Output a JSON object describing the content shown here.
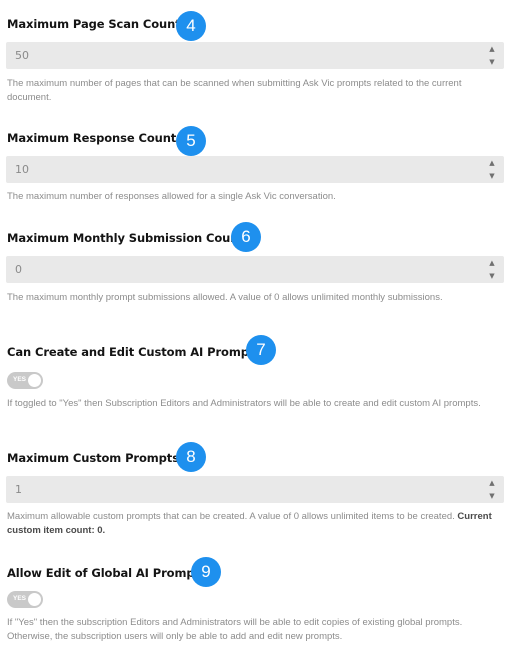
{
  "settings": [
    {
      "label": "Maximum Page Scan Count",
      "badge": "4",
      "value": "50",
      "help": "The maximum number of pages that can be scanned when submitting Ask Vic prompts related to the current document."
    },
    {
      "label": "Maximum Response Count",
      "badge": "5",
      "value": "10",
      "help": "The maximum number of responses allowed for a single Ask Vic conversation."
    },
    {
      "label": "Maximum Monthly Submission Count",
      "badge": "6",
      "value": "0",
      "help": "The maximum monthly prompt submissions allowed. A value of 0 allows unlimited monthly submissions."
    },
    {
      "label": "Can Create and Edit Custom AI Prompts",
      "badge": "7",
      "toggle": "YES",
      "help": "If toggled to \"Yes\" then Subscription Editors and Administrators will be able to create and edit custom AI prompts."
    },
    {
      "label": "Maximum Custom Prompts",
      "badge": "8",
      "value": "1",
      "help": "Maximum allowable custom prompts that can be created. A value of 0 allows unlimited items to be created.",
      "help_bold": "Current custom item count: 0."
    },
    {
      "label": "Allow Edit of Global AI Prompts",
      "badge": "9",
      "toggle": "YES",
      "help": "If \"Yes\" then the subscription Editors and Administrators will be able to edit copies of existing global prompts. Otherwise, the subscription users will only be able to add and edit new prompts."
    }
  ],
  "icons": {
    "up": "triangle-up",
    "down": "triangle-down"
  },
  "colors": {
    "badge": "#1e90ee",
    "field": "#e9e9e9",
    "toggle": "#c9c9c9"
  }
}
